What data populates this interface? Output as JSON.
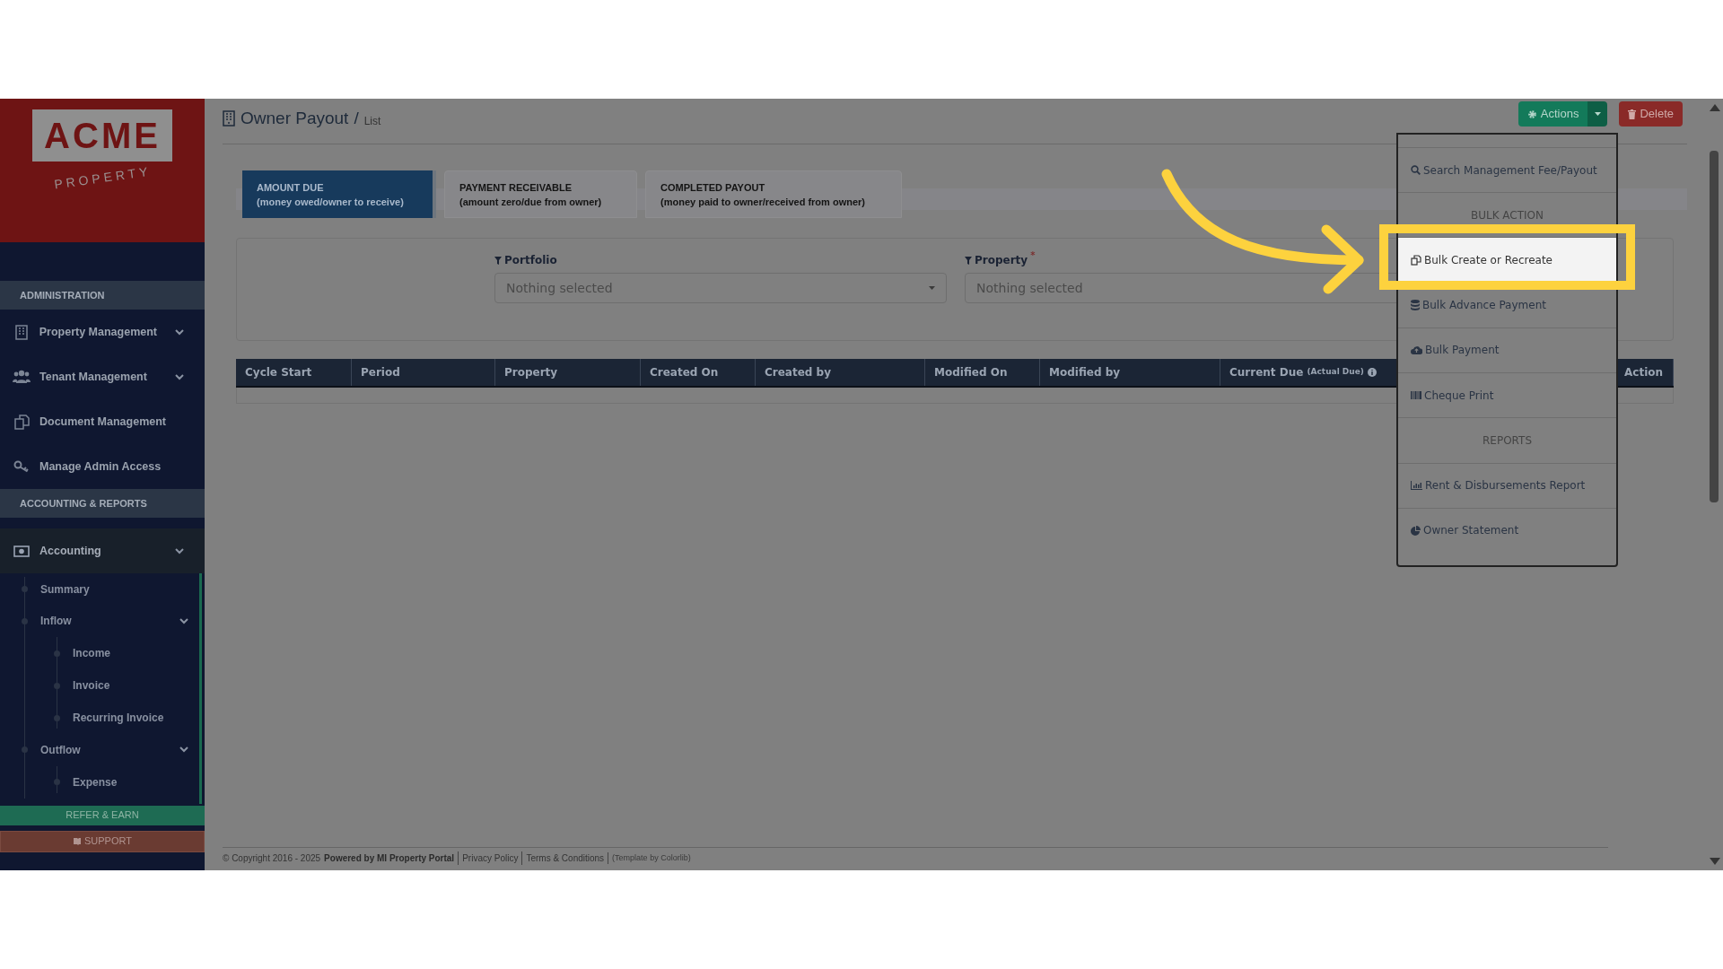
{
  "logo": {
    "wordmark": "ACME",
    "tagline": "PROPERTY"
  },
  "sidebar": {
    "sections": [
      {
        "title": "ADMINISTRATION",
        "items": [
          {
            "label": "Property Management",
            "has_submenu": true,
            "selected": false
          },
          {
            "label": "Tenant Management",
            "has_submenu": true,
            "selected": false
          },
          {
            "label": "Document Management",
            "has_submenu": false,
            "selected": false
          },
          {
            "label": "Manage Admin Access",
            "has_submenu": false,
            "selected": false
          }
        ]
      },
      {
        "title": "ACCOUNTING & REPORTS",
        "items": [
          {
            "label": "Accounting",
            "has_submenu": true,
            "selected": true,
            "children": [
              {
                "label": "Summary",
                "has_submenu": false
              },
              {
                "label": "Inflow",
                "has_submenu": true,
                "children": [
                  {
                    "label": "Income"
                  },
                  {
                    "label": "Invoice"
                  },
                  {
                    "label": "Recurring Invoice"
                  }
                ]
              },
              {
                "label": "Outflow",
                "has_submenu": true,
                "children": [
                  {
                    "label": "Expense"
                  }
                ]
              }
            ]
          }
        ]
      }
    ],
    "buttons": [
      {
        "label": "REFER & EARN",
        "kind": "refer"
      },
      {
        "label": "SUPPORT",
        "kind": "support"
      }
    ]
  },
  "header": {
    "title": "Owner Payout",
    "separator": "/",
    "breadcrumb": "List"
  },
  "toolbar": {
    "actions": "Actions",
    "delete": "Delete"
  },
  "tabs": [
    {
      "title": "AMOUNT DUE",
      "subtitle": "(money owed/owner to receive)",
      "selected": true
    },
    {
      "title": "PAYMENT RECEIVABLE",
      "subtitle": "(amount zero/due from owner)",
      "selected": false
    },
    {
      "title": "COMPLETED PAYOUT",
      "subtitle": "(money paid to owner/received from owner)",
      "selected": false
    }
  ],
  "filters": [
    {
      "label": "Portfolio",
      "placeholder": "Nothing selected"
    },
    {
      "label": "Property",
      "required_mark": "*",
      "placeholder": "Nothing selected"
    }
  ],
  "table": {
    "columns": [
      {
        "label": "Cycle Start"
      },
      {
        "label": "Period"
      },
      {
        "label": "Property"
      },
      {
        "label": "Created On"
      },
      {
        "label": "Created by"
      },
      {
        "label": "Modified On"
      },
      {
        "label": "Modified by"
      },
      {
        "label": "Current Due",
        "note": "(Actual Due)"
      },
      {
        "label": "Action"
      }
    ]
  },
  "actions_menu": [
    {
      "kind": "item",
      "label": "Search Management Fee/Payout",
      "selected": false
    },
    {
      "kind": "header",
      "label": "BULK ACTION"
    },
    {
      "kind": "item",
      "label": "Bulk Create or Recreate",
      "selected": true
    },
    {
      "kind": "item",
      "label": "Bulk Advance Payment",
      "selected": false
    },
    {
      "kind": "item",
      "label": "Bulk Payment",
      "selected": false
    },
    {
      "kind": "item",
      "label": "Cheque Print",
      "selected": false
    },
    {
      "kind": "header",
      "label": "REPORTS"
    },
    {
      "kind": "item",
      "label": "Rent & Disbursements Report",
      "selected": false
    },
    {
      "kind": "item",
      "label": "Owner Statement",
      "selected": false
    }
  ],
  "footer": {
    "copyright": "© Copyright 2016 - 2025",
    "powered": "Powered by MI Property Portal",
    "links": [
      "Privacy Policy",
      "Terms & Conditions"
    ],
    "credit": "(Template by Colorlib)"
  }
}
